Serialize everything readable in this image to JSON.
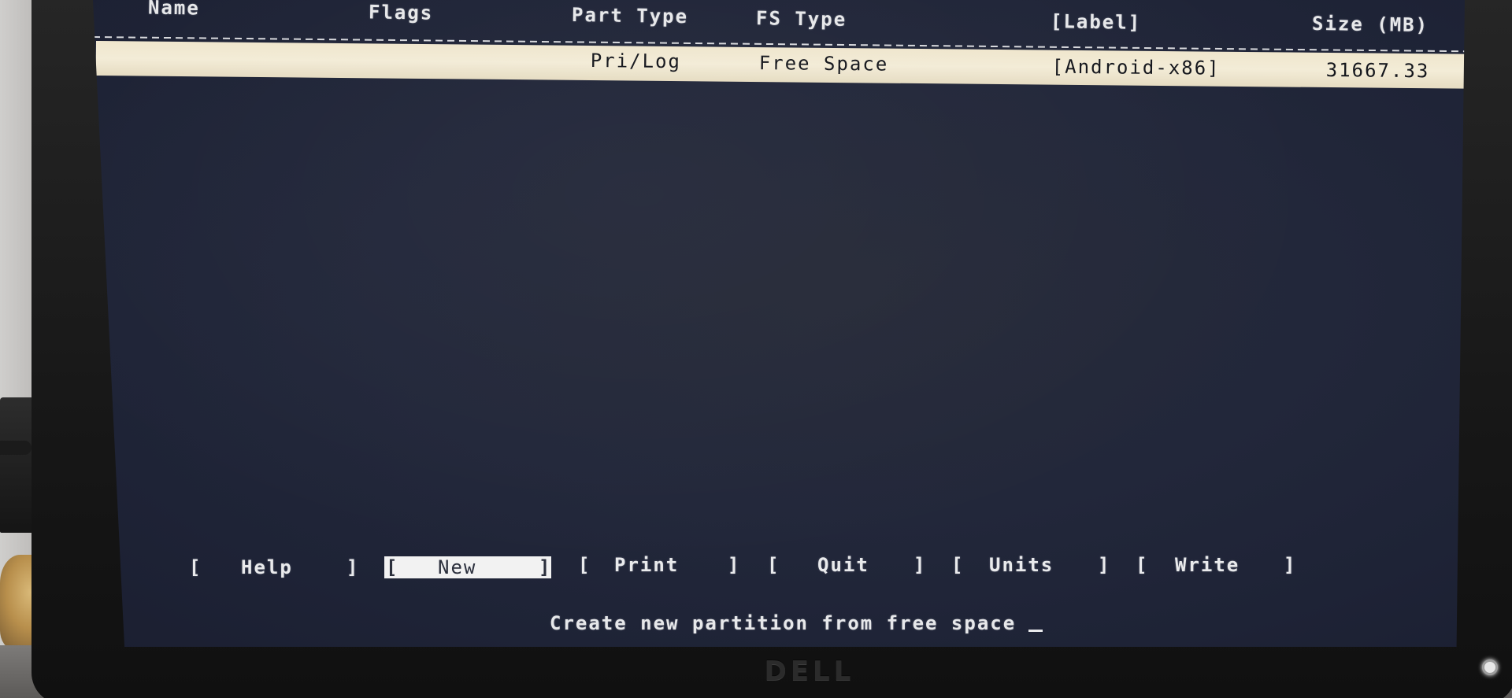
{
  "table_header": {
    "name": "Name",
    "flags": "Flags",
    "part_type": "Part Type",
    "fs_type": "FS Type",
    "label": "[Label]",
    "size": "Size (MB)"
  },
  "partition_rows": [
    {
      "name": "",
      "flags": "",
      "part_type": "Pri/Log",
      "fs_type": "Free Space",
      "label": "[Android-x86]",
      "size": "31667.33",
      "selected": true
    }
  ],
  "menu": {
    "help": "Help",
    "new": "New",
    "print": "Print",
    "quit": "Quit",
    "units": "Units",
    "write": "Write",
    "selected": "new",
    "bracket_open": "[",
    "bracket_close": "]"
  },
  "status_line": "Create new partition from free space",
  "monitor": {
    "brand": "DELL"
  },
  "colors": {
    "screen_bg": "#22273a",
    "text": "#e7e8ea",
    "highlight_row": "#f3ecd7",
    "selected_menu_bg": "#f2f2f2"
  }
}
